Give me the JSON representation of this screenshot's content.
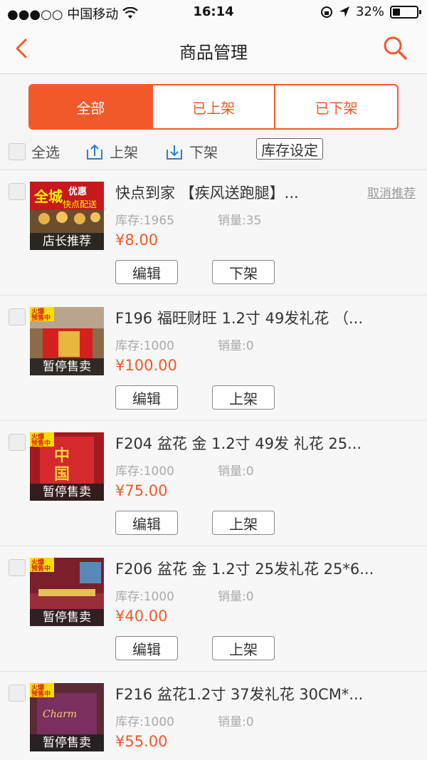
{
  "status_bar": {
    "carrier": "●●●○○ 中国移动",
    "time": "16:14",
    "battery": "32%",
    "battery_level": 0.32
  },
  "nav": {
    "title": "商品管理",
    "back_icon": "chevron-left-icon",
    "search_icon": "search-icon"
  },
  "tabs": [
    {
      "label": "全部",
      "active": true
    },
    {
      "label": "已上架",
      "active": false
    },
    {
      "label": "已下架",
      "active": false
    }
  ],
  "actions": {
    "select_all": "全选",
    "list_on": "上架",
    "list_off": "下架",
    "stock_setting": "库存设定"
  },
  "products": [
    {
      "name": "快点到家 【疾风送跑腿】...",
      "badge": "店长推荐",
      "image_text": "全城 优惠 快点配送",
      "stock": "库存:1965",
      "sales": "销量:35",
      "price": "¥8.00",
      "edit": "编辑",
      "toggle": "下架",
      "recommend": "取消推荐"
    },
    {
      "name": "F196 福旺财旺 1.2寸 49发礼花 （...",
      "badge": "暂停售卖",
      "image_text": "火爆 预售中",
      "stock": "库存:1000",
      "sales": "销量:0",
      "price": "¥100.00",
      "edit": "编辑",
      "toggle": "上架"
    },
    {
      "name": "F204 盆花 金 1.2寸 49发 礼花 25...",
      "badge": "暂停售卖",
      "image_text": "火爆 预售中",
      "stock": "库存:1000",
      "sales": "销量:0",
      "price": "¥75.00",
      "edit": "编辑",
      "toggle": "上架"
    },
    {
      "name": "F206 盆花 金 1.2寸 25发礼花 25*6...",
      "badge": "暂停售卖",
      "image_text": "火爆 预售中",
      "stock": "库存:1000",
      "sales": "销量:0",
      "price": "¥40.00",
      "edit": "编辑",
      "toggle": "上架"
    },
    {
      "name": "F216 盆花1.2寸 37发礼花 30CM*...",
      "badge": "暂停售卖",
      "image_text": "火爆 预售中",
      "stock": "库存:1000",
      "sales": "销量:0",
      "price": "¥55.00",
      "edit": "编辑",
      "toggle": "上架"
    }
  ],
  "colors": {
    "accent": "#f2592a",
    "price": "#f2592a"
  }
}
